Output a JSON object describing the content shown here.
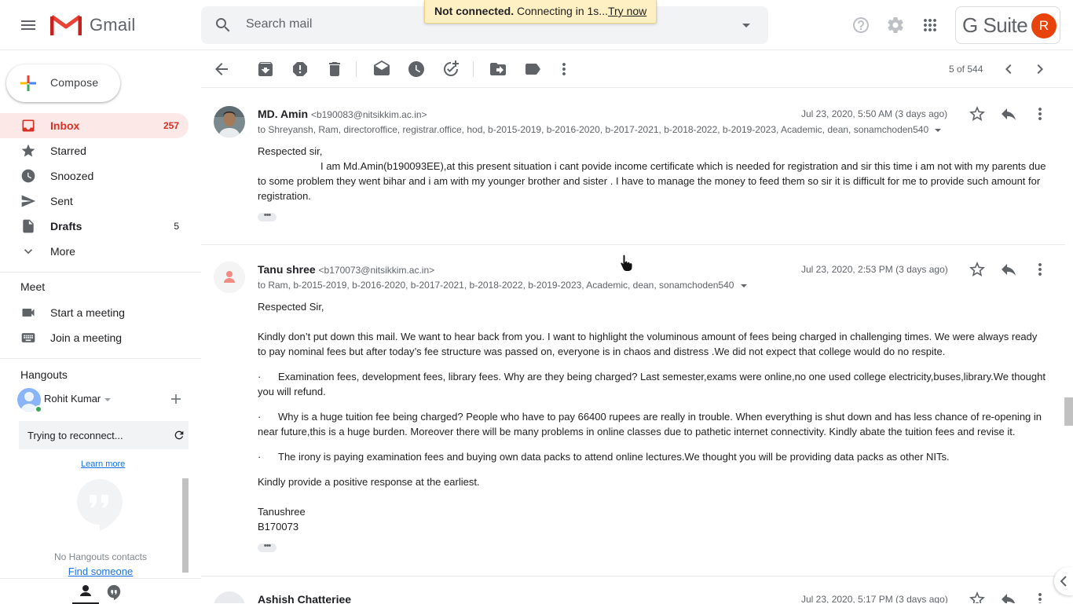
{
  "header": {
    "app_name": "Gmail",
    "search_placeholder": "Search mail",
    "toast": {
      "status": "Not connected.",
      "message": "Connecting in 1s...",
      "action": "Try now"
    },
    "gsuite_label": "G Suite",
    "account_initial": "R"
  },
  "sidebar": {
    "compose_label": "Compose",
    "items": [
      {
        "label": "Inbox",
        "count": "257",
        "icon": "inbox-icon",
        "active": true
      },
      {
        "label": "Starred",
        "count": "",
        "icon": "star-icon"
      },
      {
        "label": "Snoozed",
        "count": "",
        "icon": "clock-icon"
      },
      {
        "label": "Sent",
        "count": "",
        "icon": "send-icon"
      },
      {
        "label": "Drafts",
        "count": "5",
        "icon": "draft-icon"
      },
      {
        "label": "More",
        "count": "",
        "icon": "chevron-down-icon"
      }
    ],
    "meet": {
      "title": "Meet",
      "items": [
        {
          "label": "Start a meeting",
          "icon": "video-camera-icon"
        },
        {
          "label": "Join a meeting",
          "icon": "keyboard-icon"
        }
      ]
    },
    "hangouts": {
      "title": "Hangouts",
      "user_name": "Rohit Kumar",
      "reconnect_text": "Trying to reconnect...",
      "learn_more": "Learn more",
      "no_contacts": "No Hangouts contacts",
      "find_someone": "Find someone"
    }
  },
  "toolbar": {
    "counter": "5 of 544",
    "icons": [
      "back-arrow-icon",
      "archive-icon",
      "report-spam-icon",
      "delete-icon",
      "mark-unread-icon",
      "snooze-icon",
      "add-to-tasks-icon",
      "move-to-icon",
      "label-icon",
      "more-vert-icon"
    ]
  },
  "messages": [
    {
      "sender_name": "MD. Amin",
      "sender_email": "<b190083@nitsikkim.ac.in>",
      "recipients": "to Shreyansh, Ram, directoroffice, registrar.office, hod, b-2015-2019, b-2016-2020, b-2017-2021, b-2018-2022, b-2019-2023, Academic, dean, sonamchoden540",
      "date": "Jul 23, 2020, 5:50 AM (3 days ago)",
      "greeting": "Respected sir,",
      "paragraph": "I am Md.Amin(b190093EE),at this present situation i cant povide income certificate which is needed for registration and sir this time i am not with my parents due to some problem they went bihar and i am with my younger brother and sister . I have to manage the money to feed them so sir it is difficult for me to provide such amount for registration."
    },
    {
      "sender_name": "Tanu shree",
      "sender_email": "<b170073@nitsikkim.ac.in>",
      "recipients": "to Ram, b-2015-2019, b-2016-2020, b-2017-2021, b-2018-2022, b-2019-2023, Academic, dean, sonamchoden540",
      "date": "Jul 23, 2020, 2:53 PM (3 days ago)",
      "greeting": "Respected Sir,",
      "paragraph": "Kindly don’t put down this mail. We want to hear back from you. I want to highlight the voluminous amount of fees being charged in challenging times. We were always ready to pay nominal fees but after today’s fee structure was passed on, everyone is in chaos and distress .We did not expect that college would do no respite.",
      "bullets": [
        "Examination fees, development fees, library fees. Why are they being charged? Last semester,exams were online,no one used college electricity,buses,library.We thought you will refund.",
        "Why is a huge tuition fee being charged? People who have to pay 66400 rupees are really in trouble. When everything is shut down and has less chance of re-opening in near future,this is a huge burden. Moreover there will be many problems in online classes due to pathetic internet connectivity. Kindly abate the tuition fees and revise it.",
        "The irony is paying examination fees and buying own data packs to attend online lectures.We thought you will be providing data packs as other NITs."
      ],
      "closing": "Kindly provide a positive response at the earliest.",
      "signature_name": "Tanushree",
      "signature_id": "B170073"
    },
    {
      "sender_name": "Ashish Chatterjee",
      "date": "Jul 23, 2020, 5:17 PM (3 days ago)"
    }
  ],
  "colors": {
    "accent_red": "#d93025",
    "active_bg": "#fce8e6",
    "link_blue": "#1a73e8",
    "toast_bg": "#fef0c3"
  }
}
